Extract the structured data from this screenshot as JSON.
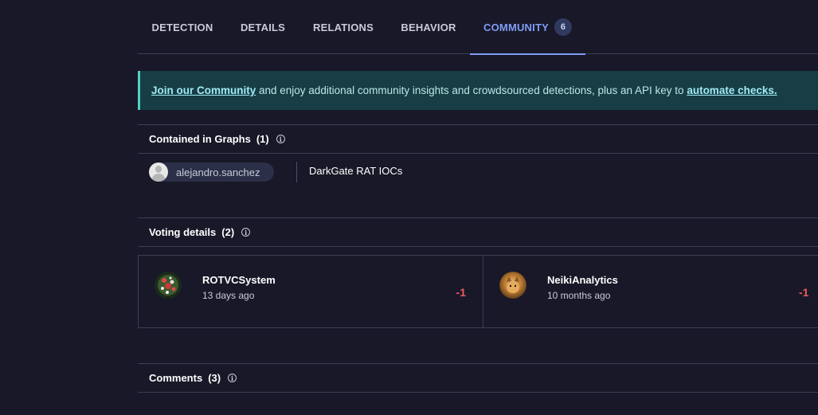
{
  "tabs": [
    {
      "label": "DETECTION"
    },
    {
      "label": "DETAILS"
    },
    {
      "label": "RELATIONS"
    },
    {
      "label": "BEHAVIOR"
    },
    {
      "label": "COMMUNITY",
      "badge": "6",
      "active": true
    }
  ],
  "banner": {
    "join_link": "Join our Community",
    "text_middle": " and enjoy additional community insights and crowdsourced detections, plus an API key to ",
    "automate_link": "automate checks."
  },
  "graphs": {
    "title": "Contained in Graphs",
    "count": "(1)",
    "items": [
      {
        "user": "alejandro.sanchez",
        "graph_name": "DarkGate RAT IOCs"
      }
    ]
  },
  "voting": {
    "title": "Voting details",
    "count": "(2)",
    "votes": [
      {
        "user": "ROTVCSystem",
        "time": "13 days ago",
        "value": "-1"
      },
      {
        "user": "NeikiAnalytics",
        "time": "10 months ago",
        "value": "-1"
      }
    ]
  },
  "comments": {
    "title": "Comments",
    "count": "(3)"
  },
  "icons": {
    "info": "info-icon",
    "user_avatar": "default-user-avatar",
    "vote_avatars": [
      "rotvcsystem-avatar",
      "neikianalytics-avatar"
    ]
  },
  "colors": {
    "background": "#181828",
    "accent": "#7f9cf5",
    "banner_bg": "#183d45",
    "banner_border": "#4fd1c5",
    "negative_vote": "#f05a5a"
  }
}
